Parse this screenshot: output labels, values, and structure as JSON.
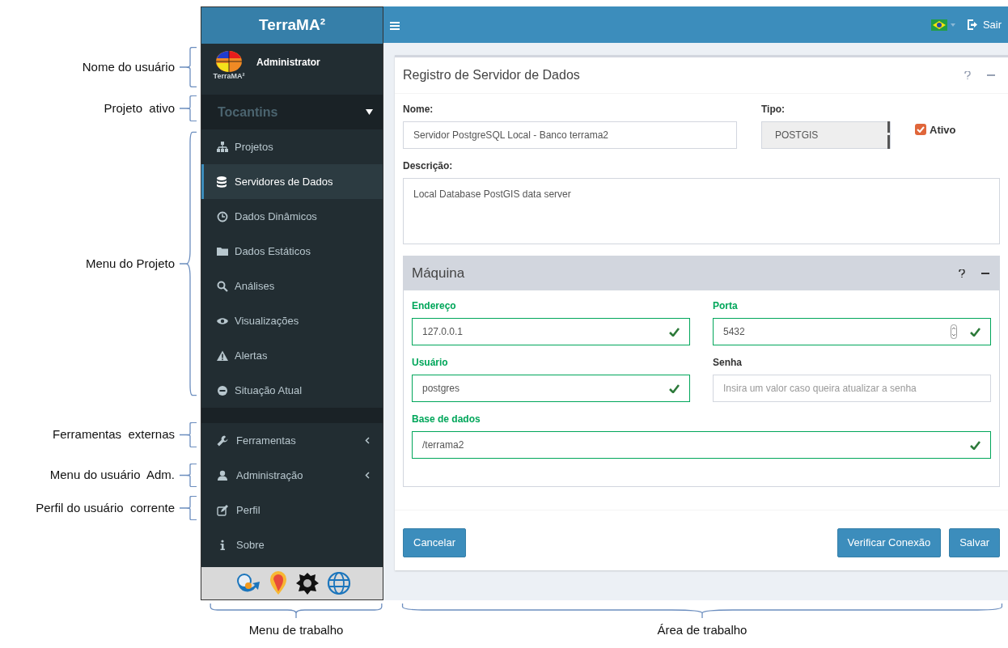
{
  "annotations": {
    "left": [
      {
        "label": "Nome do usuário"
      },
      {
        "label": "Projeto  ativo"
      },
      {
        "label": "Menu do Projeto"
      },
      {
        "label": "Ferramentas  externas"
      },
      {
        "label": "Menu do usuário  Adm."
      },
      {
        "label": "Perfil do usuário  corrente"
      }
    ],
    "bottom": [
      {
        "label": "Menu de trabalho"
      },
      {
        "label": "Área de trabalho"
      }
    ]
  },
  "app": {
    "brand": "TerraMA²",
    "user": {
      "name": "Administrator",
      "logo_caption": "TerraMA²"
    },
    "project": {
      "name": "Tocantins"
    },
    "project_menu": [
      {
        "label": "Projetos",
        "selected": false
      },
      {
        "label": "Servidores de Dados",
        "selected": true
      },
      {
        "label": "Dados Dinâmicos",
        "selected": false
      },
      {
        "label": "Dados Estáticos",
        "selected": false
      },
      {
        "label": "Análises",
        "selected": false
      },
      {
        "label": "Visualizações",
        "selected": false
      },
      {
        "label": "Alertas",
        "selected": false
      },
      {
        "label": "Situação Atual",
        "selected": false
      }
    ],
    "other_menu": [
      {
        "label": "Ferramentas",
        "expandable": true
      },
      {
        "label": "Administração",
        "expandable": true
      },
      {
        "label": "Perfil",
        "expandable": false
      },
      {
        "label": "Sobre",
        "expandable": false
      }
    ],
    "topbar": {
      "logout": "Sair"
    },
    "form": {
      "title": "Registro de Servidor de Dados",
      "name": {
        "label": "Nome:",
        "value": "Servidor PostgreSQL Local - Banco terrama2"
      },
      "type": {
        "label": "Tipo:",
        "value": "POSTGIS"
      },
      "active": {
        "label": "Ativo",
        "checked": true
      },
      "description": {
        "label": "Descrição:",
        "value": "Local Database PostGIS data server"
      },
      "machine": {
        "title": "Máquina",
        "fields": [
          {
            "label": "Endereço",
            "value": "127.0.0.1",
            "valid": true,
            "kind": "text"
          },
          {
            "label": "Porta",
            "value": "5432",
            "valid": true,
            "kind": "number"
          },
          {
            "label": "Usuário",
            "value": "postgres",
            "valid": true,
            "kind": "text"
          },
          {
            "label": "Senha",
            "placeholder": "Insira um valor caso queira atualizar a senha",
            "valid": false,
            "kind": "text"
          },
          {
            "label": "Base de dados",
            "value": "/terrama2",
            "valid": true,
            "kind": "text"
          }
        ]
      },
      "buttons_left": [
        "Cancelar"
      ],
      "buttons_right": [
        "Verificar Conexão",
        "Salvar"
      ]
    }
  }
}
